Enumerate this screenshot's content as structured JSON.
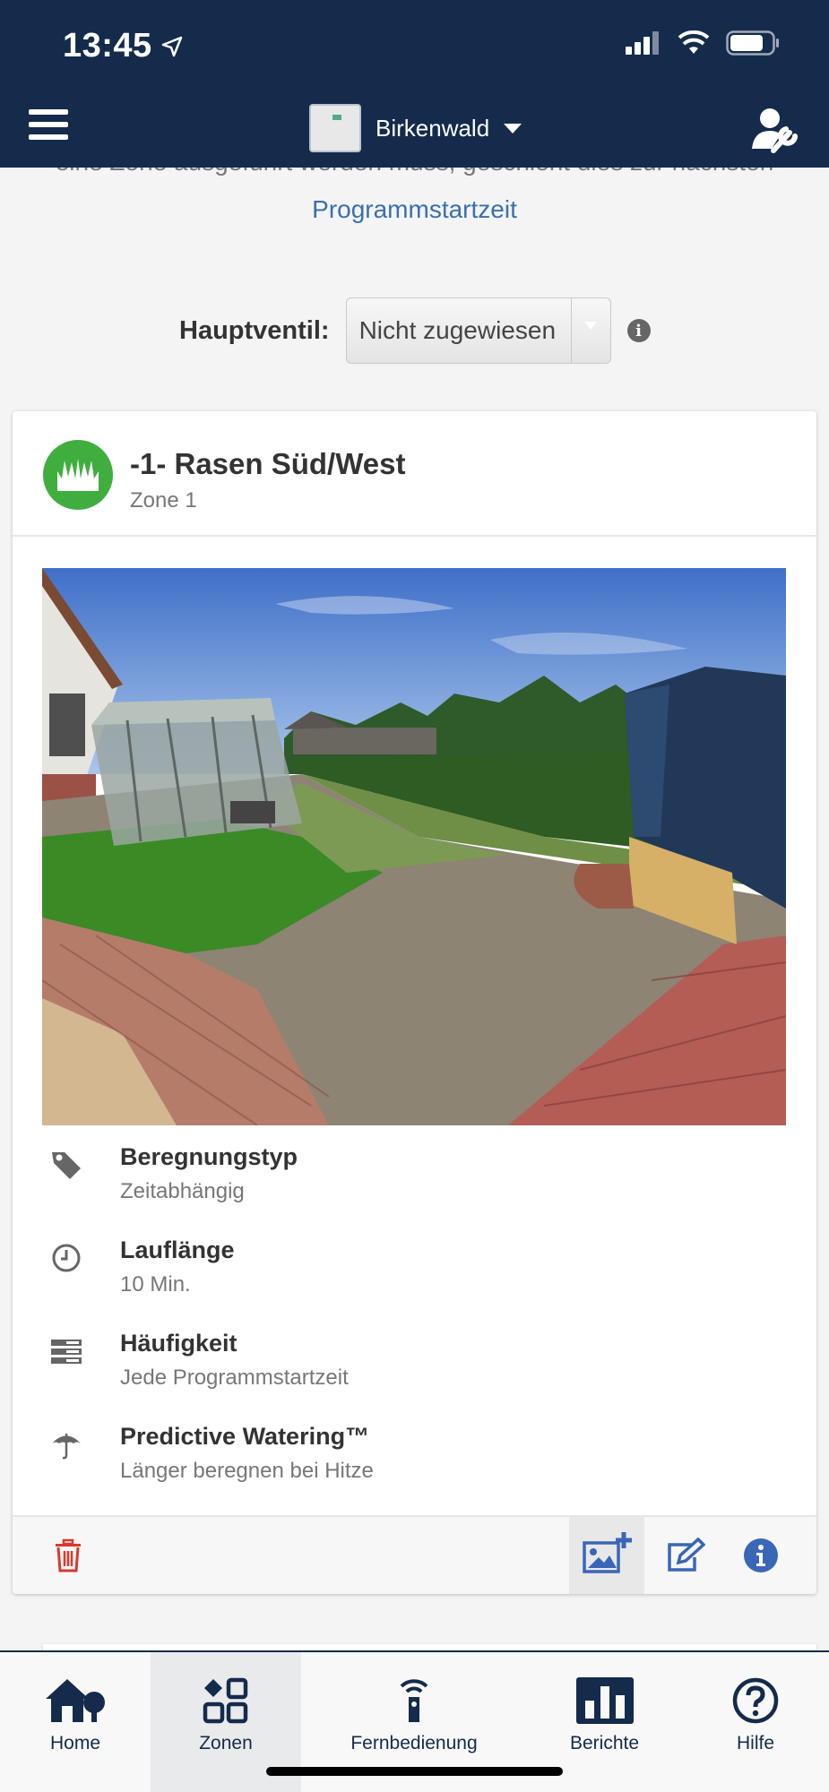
{
  "status_bar": {
    "time": "13:45"
  },
  "header": {
    "controller_name": "Birkenwald"
  },
  "intro": {
    "partial_text": "eine Zone ausgeführt werden muss, geschieht dies zur nächsten",
    "link_text": "Programmstartzeit"
  },
  "master_valve": {
    "label": "Hauptventil:",
    "value": "Nicht zugewiesen"
  },
  "zone": {
    "title": "-1- Rasen Süd/West",
    "subtitle": "Zone 1",
    "details": [
      {
        "label": "Beregnungstyp",
        "value": "Zeitabhängig",
        "icon": "tag-icon"
      },
      {
        "label": "Lauflänge",
        "value": "10 Min.",
        "icon": "clock-icon"
      },
      {
        "label": "Häufigkeit",
        "value": "Jede Programmstartzeit",
        "icon": "list-icon"
      },
      {
        "label": "Predictive Watering™",
        "value": "Länger beregnen bei Hitze",
        "icon": "umbrella-icon"
      }
    ]
  },
  "colors": {
    "header_bg": "#142b4c",
    "zone_green": "#3fae3f",
    "link_blue": "#3a6fb0",
    "delete_red": "#d9382f",
    "action_blue": "#3a66b7"
  },
  "bottom_nav": [
    {
      "label": "Home",
      "icon": "home-icon"
    },
    {
      "label": "Zonen",
      "icon": "zones-grid-icon"
    },
    {
      "label": "Fernbedienung",
      "icon": "remote-icon"
    },
    {
      "label": "Berichte",
      "icon": "reports-chart-icon"
    },
    {
      "label": "Hilfe",
      "icon": "help-icon"
    }
  ]
}
